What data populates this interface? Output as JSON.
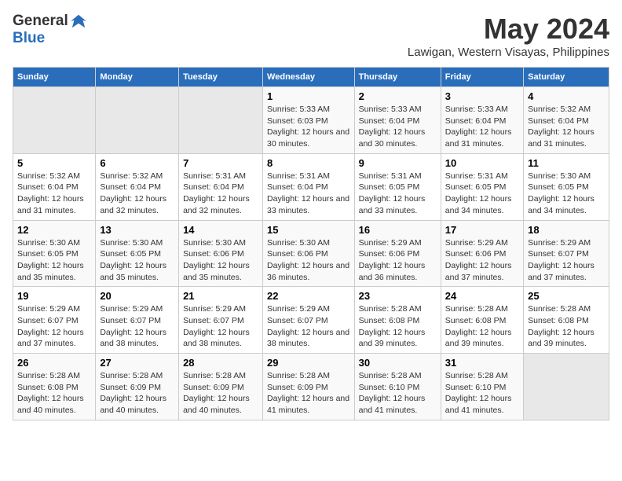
{
  "header": {
    "logo_general": "General",
    "logo_blue": "Blue",
    "month_title": "May 2024",
    "location": "Lawigan, Western Visayas, Philippines"
  },
  "days_of_week": [
    "Sunday",
    "Monday",
    "Tuesday",
    "Wednesday",
    "Thursday",
    "Friday",
    "Saturday"
  ],
  "weeks": [
    [
      {
        "day": "",
        "sunrise": "",
        "sunset": "",
        "daylight": "",
        "empty": true
      },
      {
        "day": "",
        "sunrise": "",
        "sunset": "",
        "daylight": "",
        "empty": true
      },
      {
        "day": "",
        "sunrise": "",
        "sunset": "",
        "daylight": "",
        "empty": true
      },
      {
        "day": "1",
        "sunrise": "Sunrise: 5:33 AM",
        "sunset": "Sunset: 6:03 PM",
        "daylight": "Daylight: 12 hours and 30 minutes."
      },
      {
        "day": "2",
        "sunrise": "Sunrise: 5:33 AM",
        "sunset": "Sunset: 6:04 PM",
        "daylight": "Daylight: 12 hours and 30 minutes."
      },
      {
        "day": "3",
        "sunrise": "Sunrise: 5:33 AM",
        "sunset": "Sunset: 6:04 PM",
        "daylight": "Daylight: 12 hours and 31 minutes."
      },
      {
        "day": "4",
        "sunrise": "Sunrise: 5:32 AM",
        "sunset": "Sunset: 6:04 PM",
        "daylight": "Daylight: 12 hours and 31 minutes."
      }
    ],
    [
      {
        "day": "5",
        "sunrise": "Sunrise: 5:32 AM",
        "sunset": "Sunset: 6:04 PM",
        "daylight": "Daylight: 12 hours and 31 minutes."
      },
      {
        "day": "6",
        "sunrise": "Sunrise: 5:32 AM",
        "sunset": "Sunset: 6:04 PM",
        "daylight": "Daylight: 12 hours and 32 minutes."
      },
      {
        "day": "7",
        "sunrise": "Sunrise: 5:31 AM",
        "sunset": "Sunset: 6:04 PM",
        "daylight": "Daylight: 12 hours and 32 minutes."
      },
      {
        "day": "8",
        "sunrise": "Sunrise: 5:31 AM",
        "sunset": "Sunset: 6:04 PM",
        "daylight": "Daylight: 12 hours and 33 minutes."
      },
      {
        "day": "9",
        "sunrise": "Sunrise: 5:31 AM",
        "sunset": "Sunset: 6:05 PM",
        "daylight": "Daylight: 12 hours and 33 minutes."
      },
      {
        "day": "10",
        "sunrise": "Sunrise: 5:31 AM",
        "sunset": "Sunset: 6:05 PM",
        "daylight": "Daylight: 12 hours and 34 minutes."
      },
      {
        "day": "11",
        "sunrise": "Sunrise: 5:30 AM",
        "sunset": "Sunset: 6:05 PM",
        "daylight": "Daylight: 12 hours and 34 minutes."
      }
    ],
    [
      {
        "day": "12",
        "sunrise": "Sunrise: 5:30 AM",
        "sunset": "Sunset: 6:05 PM",
        "daylight": "Daylight: 12 hours and 35 minutes."
      },
      {
        "day": "13",
        "sunrise": "Sunrise: 5:30 AM",
        "sunset": "Sunset: 6:05 PM",
        "daylight": "Daylight: 12 hours and 35 minutes."
      },
      {
        "day": "14",
        "sunrise": "Sunrise: 5:30 AM",
        "sunset": "Sunset: 6:06 PM",
        "daylight": "Daylight: 12 hours and 35 minutes."
      },
      {
        "day": "15",
        "sunrise": "Sunrise: 5:30 AM",
        "sunset": "Sunset: 6:06 PM",
        "daylight": "Daylight: 12 hours and 36 minutes."
      },
      {
        "day": "16",
        "sunrise": "Sunrise: 5:29 AM",
        "sunset": "Sunset: 6:06 PM",
        "daylight": "Daylight: 12 hours and 36 minutes."
      },
      {
        "day": "17",
        "sunrise": "Sunrise: 5:29 AM",
        "sunset": "Sunset: 6:06 PM",
        "daylight": "Daylight: 12 hours and 37 minutes."
      },
      {
        "day": "18",
        "sunrise": "Sunrise: 5:29 AM",
        "sunset": "Sunset: 6:07 PM",
        "daylight": "Daylight: 12 hours and 37 minutes."
      }
    ],
    [
      {
        "day": "19",
        "sunrise": "Sunrise: 5:29 AM",
        "sunset": "Sunset: 6:07 PM",
        "daylight": "Daylight: 12 hours and 37 minutes."
      },
      {
        "day": "20",
        "sunrise": "Sunrise: 5:29 AM",
        "sunset": "Sunset: 6:07 PM",
        "daylight": "Daylight: 12 hours and 38 minutes."
      },
      {
        "day": "21",
        "sunrise": "Sunrise: 5:29 AM",
        "sunset": "Sunset: 6:07 PM",
        "daylight": "Daylight: 12 hours and 38 minutes."
      },
      {
        "day": "22",
        "sunrise": "Sunrise: 5:29 AM",
        "sunset": "Sunset: 6:07 PM",
        "daylight": "Daylight: 12 hours and 38 minutes."
      },
      {
        "day": "23",
        "sunrise": "Sunrise: 5:28 AM",
        "sunset": "Sunset: 6:08 PM",
        "daylight": "Daylight: 12 hours and 39 minutes."
      },
      {
        "day": "24",
        "sunrise": "Sunrise: 5:28 AM",
        "sunset": "Sunset: 6:08 PM",
        "daylight": "Daylight: 12 hours and 39 minutes."
      },
      {
        "day": "25",
        "sunrise": "Sunrise: 5:28 AM",
        "sunset": "Sunset: 6:08 PM",
        "daylight": "Daylight: 12 hours and 39 minutes."
      }
    ],
    [
      {
        "day": "26",
        "sunrise": "Sunrise: 5:28 AM",
        "sunset": "Sunset: 6:08 PM",
        "daylight": "Daylight: 12 hours and 40 minutes."
      },
      {
        "day": "27",
        "sunrise": "Sunrise: 5:28 AM",
        "sunset": "Sunset: 6:09 PM",
        "daylight": "Daylight: 12 hours and 40 minutes."
      },
      {
        "day": "28",
        "sunrise": "Sunrise: 5:28 AM",
        "sunset": "Sunset: 6:09 PM",
        "daylight": "Daylight: 12 hours and 40 minutes."
      },
      {
        "day": "29",
        "sunrise": "Sunrise: 5:28 AM",
        "sunset": "Sunset: 6:09 PM",
        "daylight": "Daylight: 12 hours and 41 minutes."
      },
      {
        "day": "30",
        "sunrise": "Sunrise: 5:28 AM",
        "sunset": "Sunset: 6:10 PM",
        "daylight": "Daylight: 12 hours and 41 minutes."
      },
      {
        "day": "31",
        "sunrise": "Sunrise: 5:28 AM",
        "sunset": "Sunset: 6:10 PM",
        "daylight": "Daylight: 12 hours and 41 minutes."
      },
      {
        "day": "",
        "sunrise": "",
        "sunset": "",
        "daylight": "",
        "empty": true
      }
    ]
  ]
}
